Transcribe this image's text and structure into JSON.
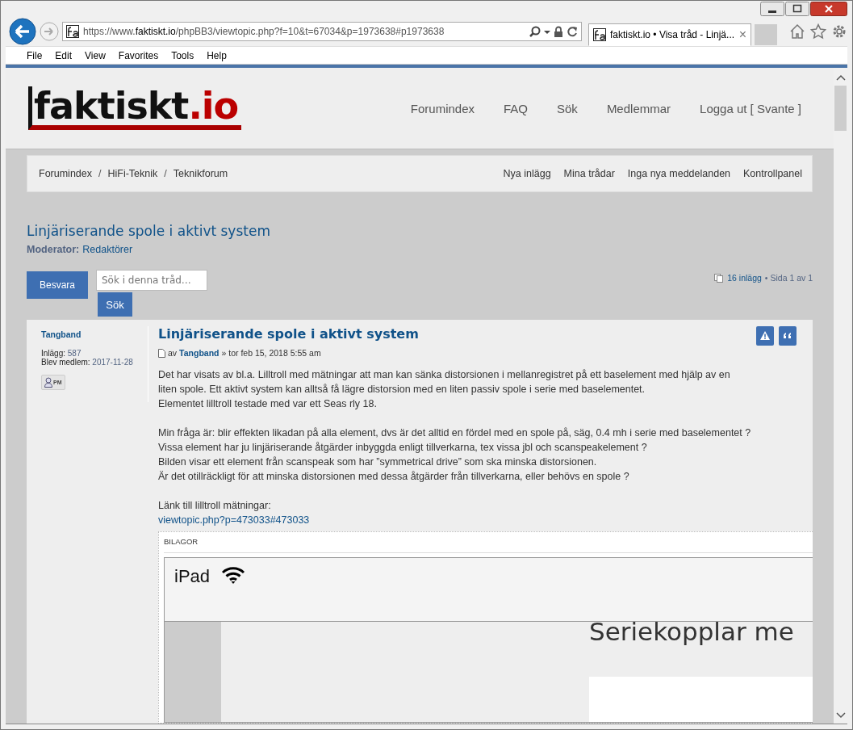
{
  "browser": {
    "address": {
      "scheme": "https://www.",
      "domain": "faktiskt.io",
      "path": "/phpBB3/viewtopic.php?f=10&t=67034&p=1973638#p1973638"
    },
    "tabs": [
      {
        "title": "faktiskt.io • Visa tråd - Linjä...",
        "selected": true,
        "close": "×"
      }
    ],
    "menu": [
      "File",
      "Edit",
      "View",
      "Favorites",
      "Tools",
      "Help"
    ]
  },
  "header": {
    "logo": {
      "main": "faktiskt",
      "accent": ".io"
    },
    "nav": [
      "Forumindex",
      "FAQ",
      "Sök",
      "Medlemmar",
      "Logga ut [ Svante ]"
    ]
  },
  "navbar": {
    "breadcrumbs": [
      "Forumindex",
      "HiFi-Teknik",
      "Teknikforum"
    ],
    "separator": "/",
    "links": [
      "Nya inlägg",
      "Mina trådar",
      "Inga nya meddelanden",
      "Kontrollpanel"
    ]
  },
  "topic": {
    "title": "Linjäriserande spole i aktivt system",
    "moderator_label": "Moderator:",
    "moderator": "Redaktörer"
  },
  "actions": {
    "reply": "Besvara",
    "search_placeholder": "Sök i denna tråd…",
    "search_button": "Sök",
    "post_count": "16 inlägg",
    "pages": "• Sida 1 av 1"
  },
  "post": {
    "author": "Tangband",
    "profile": [
      {
        "label": "Inlägg:",
        "value": "587"
      },
      {
        "label": "Blev medlem:",
        "value": "2017-11-28"
      }
    ],
    "pm": "PM",
    "title": "Linjäriserande spole i aktivt system",
    "by": "av",
    "by_author": "Tangband",
    "date": "» tor feb 15, 2018 5:55 am",
    "paragraphs": [
      [
        "Det har visats av bl.a. Lilltroll med mätningar att man kan sänka distorsionen i mellanregistret på ett baselement med hjälp av en",
        "liten spole. Ett aktivt system kan alltså få lägre distorsion med en liten passiv spole i serie med baselementet.",
        "Elementet lilltroll testade med var ett Seas rly 18."
      ],
      [
        "Min fråga är: blir effekten likadan på alla element, dvs är det alltid en fördel med en spole på, säg, 0.4 mh i serie med baselementet ?",
        "Vissa element har ju linjäriserande åtgärder inbyggda enligt tillverkarna, tex vissa jbl och scanspeakelement ?",
        "Bilden visar ett element från scanspeak som har ”symmetrical drive” som ska minska distorsionen.",
        "Är det otillräckligt för att minska distorsionen med dessa åtgärder från tillverkarna, eller behövs en spole ?"
      ],
      [
        "Länk till lilltroll mätningar:"
      ]
    ],
    "link": "viewtopic.php?p=473033#473033",
    "attachments": {
      "heading": "BILAGOR",
      "screenshot": {
        "device": "iPad",
        "heading": "Seriekopplar me"
      }
    }
  }
}
